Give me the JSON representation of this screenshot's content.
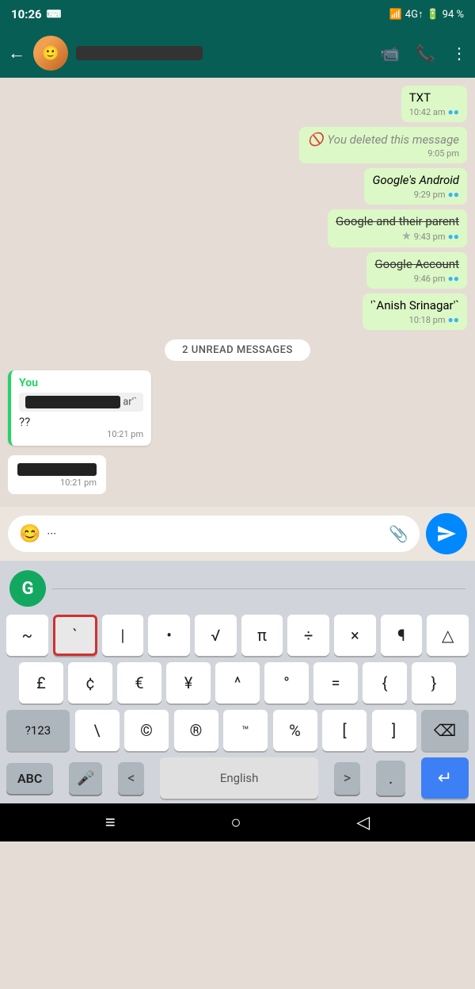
{
  "status_bar": {
    "time": "10:26",
    "signal": "4G↑",
    "battery": "94 %"
  },
  "top_bar": {
    "contact_name": "██████████████",
    "back_label": "←",
    "video_icon": "video-call",
    "call_icon": "phone",
    "more_icon": "more-vert"
  },
  "messages": [
    {
      "id": "msg1",
      "type": "outgoing",
      "text": "TXT",
      "time": "10:42 am",
      "ticks": "●●",
      "tick_color": "blue"
    },
    {
      "id": "msg2",
      "type": "outgoing",
      "deleted": true,
      "text": "You deleted this message",
      "time": "9:05 pm"
    },
    {
      "id": "msg3",
      "type": "outgoing",
      "italic": true,
      "text": "Google's Android",
      "time": "9:29 pm",
      "ticks": "●●",
      "tick_color": "blue"
    },
    {
      "id": "msg4",
      "type": "outgoing",
      "strikethrough": true,
      "text": "Google and their parent",
      "time": "9:43 pm",
      "star": "★",
      "ticks": "●●",
      "tick_color": "blue"
    },
    {
      "id": "msg5",
      "type": "outgoing",
      "strikethrough": true,
      "text": "Google Account",
      "time": "9:46 pm",
      "ticks": "●●",
      "tick_color": "blue"
    },
    {
      "id": "msg6",
      "type": "outgoing",
      "text": "'`Anish Srinagar'`",
      "time": "10:18 pm",
      "ticks": "●●",
      "tick_color": "blue"
    }
  ],
  "unread_divider": {
    "label": "2 UNREAD MESSAGES"
  },
  "reply_bubble": {
    "author": "You",
    "quoted_text": "████████████ar'`",
    "message": "??",
    "time": "10:21 pm",
    "redacted_msg": "██████",
    "redacted_time": "10:21 pm"
  },
  "input_area": {
    "placeholder": "···",
    "emoji_label": "😊",
    "attach_label": "📎",
    "send_label": "send"
  },
  "keyboard": {
    "grammarly_label": "G",
    "row1": [
      "~",
      "`",
      "|",
      "•",
      "√",
      "π",
      "÷",
      "×",
      "¶",
      "△"
    ],
    "row2": [
      "£",
      "¢",
      "€",
      "¥",
      "^",
      "°",
      "=",
      "{",
      "}"
    ],
    "row3_left": "?123",
    "row3": [
      "\\",
      "©",
      "®",
      "™",
      "%",
      "[",
      "]"
    ],
    "row3_del": "⌫",
    "bottom_left": "ABC",
    "bottom_mic": "🎤",
    "bottom_lt": "<",
    "bottom_space": "English",
    "bottom_gt": ">",
    "bottom_dot": ".",
    "bottom_enter": "↵"
  },
  "nav_bar": {
    "home_icon": "≡",
    "circle_icon": "○",
    "back_icon": "◁"
  }
}
